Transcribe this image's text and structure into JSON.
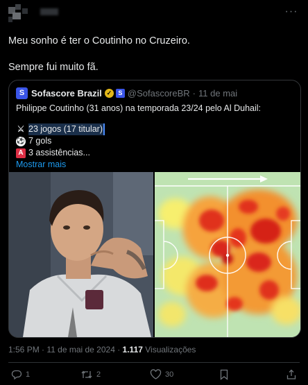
{
  "post": {
    "text_line1": "Meu sonho é ter o Coutinho no Cruzeiro.",
    "text_line2": "Sempre fui muito fã.",
    "timestamp": "1:56 PM · 11 de mai de 2024 · ",
    "views_count": "1.117",
    "views_label": " Visualizações"
  },
  "quoted": {
    "avatar_letter": "S",
    "name": "Sofascore Brazil",
    "handle": "@SofascoreBR",
    "dot": "·",
    "date": "11 de mai",
    "line1": "Philippe Coutinho (31 anos) na temporada 23/24 pelo Al Duhail:",
    "stat_games": "23 jogos (17 titular)",
    "stat_goals": "7 gols",
    "stat_assists": "3 assistências...",
    "show_more": "Mostrar mais",
    "icon_a": "A"
  },
  "actions": {
    "replies": "1",
    "reposts": "2",
    "likes": "30"
  },
  "icons": [
    "more-icon",
    "verified-icon",
    "affiliate-icon",
    "swords-icon",
    "soccer-ball-icon",
    "assist-icon",
    "reply-icon",
    "repost-icon",
    "like-icon",
    "bookmark-icon",
    "share-icon"
  ],
  "colors": {
    "accent": "#1d9bf0",
    "background": "#000000",
    "muted": "#71767b",
    "verified": "#e2b719",
    "heat": "#d9261c"
  }
}
